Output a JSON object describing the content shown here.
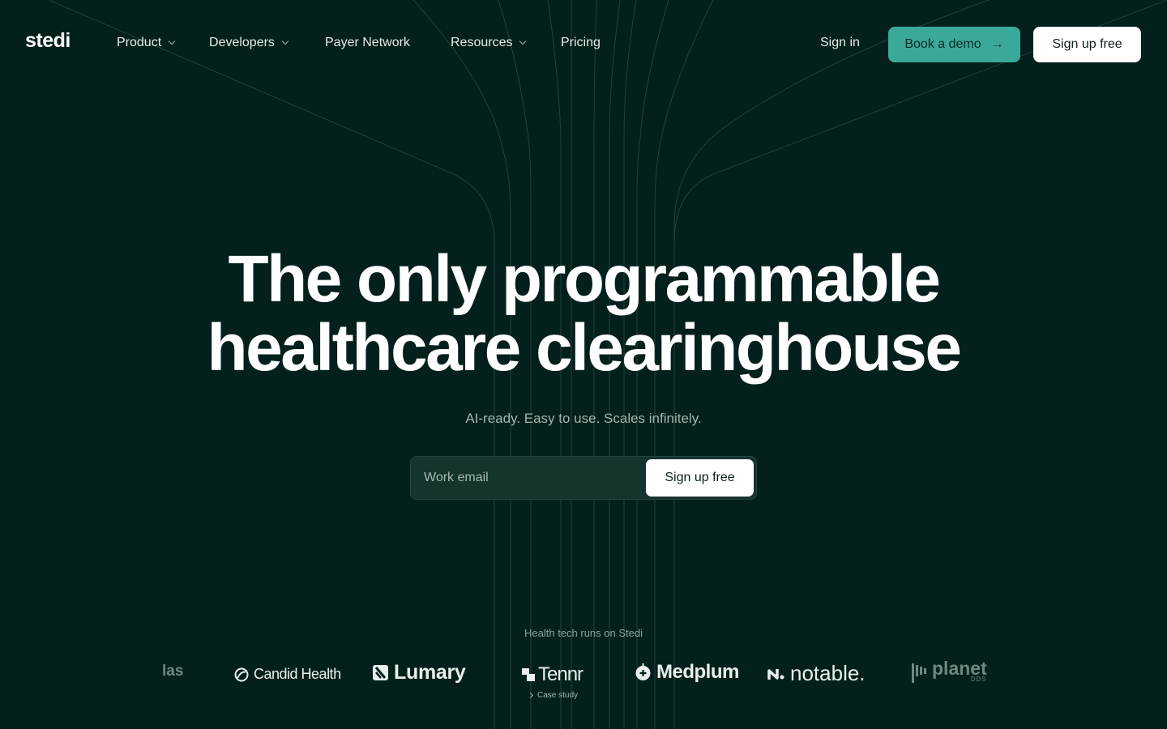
{
  "brand": {
    "logo": "stedi",
    "accent": "#3aa999",
    "background": "#04201c"
  },
  "nav": {
    "items": [
      {
        "label": "Product",
        "has_dropdown": true
      },
      {
        "label": "Developers",
        "has_dropdown": true
      },
      {
        "label": "Payer Network",
        "has_dropdown": false
      },
      {
        "label": "Resources",
        "has_dropdown": true
      },
      {
        "label": "Pricing",
        "has_dropdown": false
      }
    ],
    "sign_in": "Sign in",
    "book_demo": "Book a demo",
    "sign_up": "Sign up free"
  },
  "hero": {
    "headline_line1": "The only programmable",
    "headline_line2": "healthcare clearinghouse",
    "subheadline": "AI-ready. Easy to use. Scales infinitely.",
    "email_placeholder": "Work email",
    "cta": "Sign up free"
  },
  "customers": {
    "heading": "Health tech runs on Stedi",
    "logos": [
      {
        "name": "Atlas",
        "visible_text": "las",
        "icon": "none"
      },
      {
        "name": "Candid Health",
        "visible_text": "Candid Health",
        "icon": "candid-swirl-icon"
      },
      {
        "name": "Lumary",
        "visible_text": "Lumary",
        "icon": "lumary-leaf-icon"
      },
      {
        "name": "Tennr",
        "visible_text": "Tennr",
        "icon": "tennr-blocks-icon"
      },
      {
        "name": "Medplum",
        "visible_text": "Medplum",
        "icon": "medplum-apple-icon"
      },
      {
        "name": "notable",
        "visible_text": "notable.",
        "icon": "notable-n-icon"
      },
      {
        "name": "Planet DDS",
        "visible_text": "planet",
        "sub_text": "DDS",
        "icon": "planet-bars-icon"
      }
    ],
    "case_study_label": "Case study"
  }
}
